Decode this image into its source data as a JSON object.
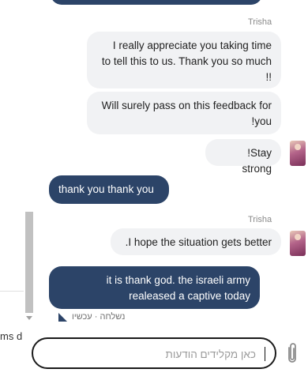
{
  "background": {
    "left_text": "ms d"
  },
  "conversation": {
    "messages": [
      {
        "sender": "Trisha",
        "direction": "incoming",
        "lines": [
          "I really appreciate you taking time",
          "to tell this to us. Thank you so much",
          "!!"
        ]
      },
      {
        "direction": "incoming",
        "lines": [
          "Will surely pass on this feedback for",
          "!you"
        ]
      },
      {
        "direction": "incoming",
        "lines": [
          "!Stay strong"
        ]
      },
      {
        "direction": "outgoing",
        "lines": [
          "thank you thank you"
        ]
      },
      {
        "sender": "Trisha",
        "direction": "incoming",
        "lines": [
          ".I hope the situation gets better"
        ]
      },
      {
        "direction": "outgoing",
        "lines": [
          "it is thank god. the israeli army",
          "realeased a captive today"
        ]
      }
    ],
    "status": "נשלחה · עכשיו"
  },
  "composer": {
    "placeholder": "כאן מקלידים הודעות",
    "value": ""
  },
  "icons": {
    "attach": "paperclip-icon",
    "sent": "sent-indicator-icon"
  },
  "colors": {
    "outgoing_bubble": "#2c4468",
    "incoming_bubble": "#f1f2f4"
  }
}
